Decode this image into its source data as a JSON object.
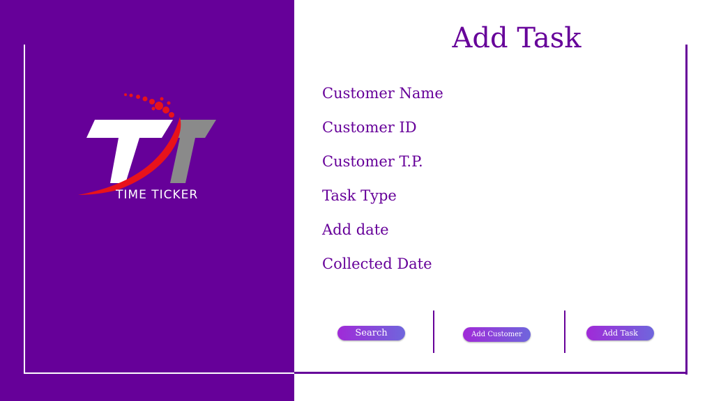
{
  "brand": {
    "logo_text": "TIME TICKER"
  },
  "page": {
    "title": "Add Task"
  },
  "form": {
    "labels": [
      "Customer Name",
      "Customer ID",
      "Customer T.P.",
      "Task Type",
      "Add date",
      "Collected Date"
    ]
  },
  "actions": {
    "search_label": "Search",
    "add_customer_label": "Add Customer",
    "add_task_label": "Add Task"
  },
  "colors": {
    "primary": "#660099",
    "button_gradient_start": "#a02ad8",
    "button_gradient_end": "#6f66dc",
    "logo_accent": "#e8131b",
    "logo_gray": "#8a8a8a"
  }
}
